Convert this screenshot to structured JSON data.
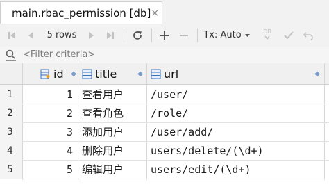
{
  "tab": {
    "title": "main.rbac_permission [db]",
    "close": "×"
  },
  "toolbar": {
    "rows_label": "5 rows",
    "tx_label": "Tx: Auto",
    "db_badge": "DB"
  },
  "filter": {
    "placeholder": "<Filter criteria>"
  },
  "columns": [
    {
      "name": "id",
      "sort": "◆"
    },
    {
      "name": "title",
      "sort": "◆"
    },
    {
      "name": "url",
      "sort": "◆"
    }
  ],
  "rows": [
    {
      "num": "1",
      "id": "1",
      "title": "查看用户",
      "url": "/user/"
    },
    {
      "num": "2",
      "id": "2",
      "title": "查看角色",
      "url": "/role/"
    },
    {
      "num": "3",
      "id": "3",
      "title": "添加用户",
      "url": "/user/add/"
    },
    {
      "num": "4",
      "id": "4",
      "title": "删除用户",
      "url": "users/delete/(\\d+)"
    },
    {
      "num": "5",
      "id": "5",
      "title": "编辑用户",
      "url": "users/edit/(\\d+)"
    }
  ],
  "colors": {
    "accent": "#3b73b9",
    "header_bg": "#f0f0f0",
    "toolbar_bg": "#f2f2f2"
  }
}
